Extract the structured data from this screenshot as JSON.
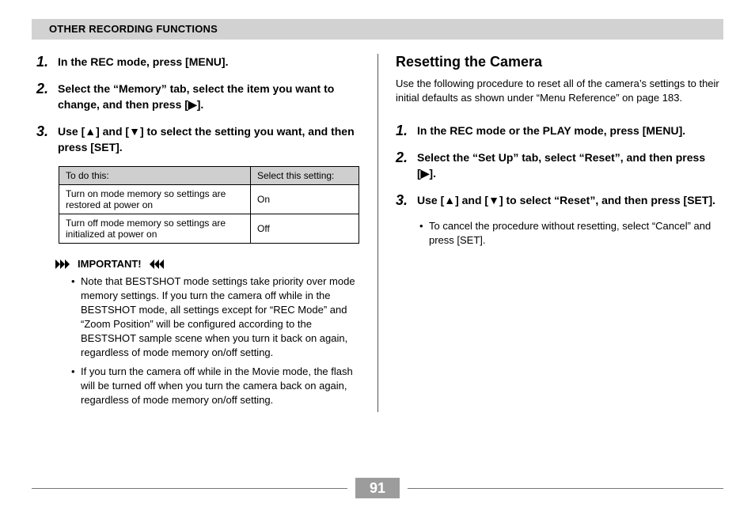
{
  "section_header": "OTHER RECORDING FUNCTIONS",
  "left": {
    "steps": [
      {
        "num": "1.",
        "text": "In the REC mode, press [MENU]."
      },
      {
        "num": "2.",
        "text": "Select the “Memory” tab, select the item you want to change, and then press [▶]."
      },
      {
        "num": "3.",
        "text": "Use [▲] and [▼] to select the setting you want, and then press [SET]."
      }
    ],
    "table": {
      "head1": "To do this:",
      "head2": "Select this setting:",
      "rows": [
        {
          "desc": "Turn on mode memory so settings are restored at power on",
          "val": "On"
        },
        {
          "desc": "Turn off mode memory so settings are initialized at power on",
          "val": "Off"
        }
      ]
    },
    "important_label": "IMPORTANT!",
    "notes": [
      "Note that BESTSHOT mode settings take priority over mode memory settings. If you turn the camera off while in the BESTSHOT mode, all settings except for “REC Mode” and “Zoom Position” will be configured according to the BESTSHOT sample scene when you turn it back on again, regardless of mode memory on/off setting.",
      "If you turn the camera off while in the Movie mode, the flash will be turned off when you turn the camera back on again, regardless of mode memory on/off setting."
    ]
  },
  "right": {
    "title": "Resetting the Camera",
    "intro": "Use the following procedure to reset all of the camera’s settings to their initial defaults as shown under “Menu Reference” on page 183.",
    "steps": [
      {
        "num": "1.",
        "text": "In the REC mode or the PLAY mode, press [MENU]."
      },
      {
        "num": "2.",
        "text": "Select the “Set Up” tab, select “Reset”, and then press [▶]."
      },
      {
        "num": "3.",
        "text": "Use [▲] and [▼] to select “Reset”, and then press [SET]."
      }
    ],
    "sub_bullet": "To cancel the procedure without resetting, select “Cancel” and press [SET]."
  },
  "page_number": "91"
}
